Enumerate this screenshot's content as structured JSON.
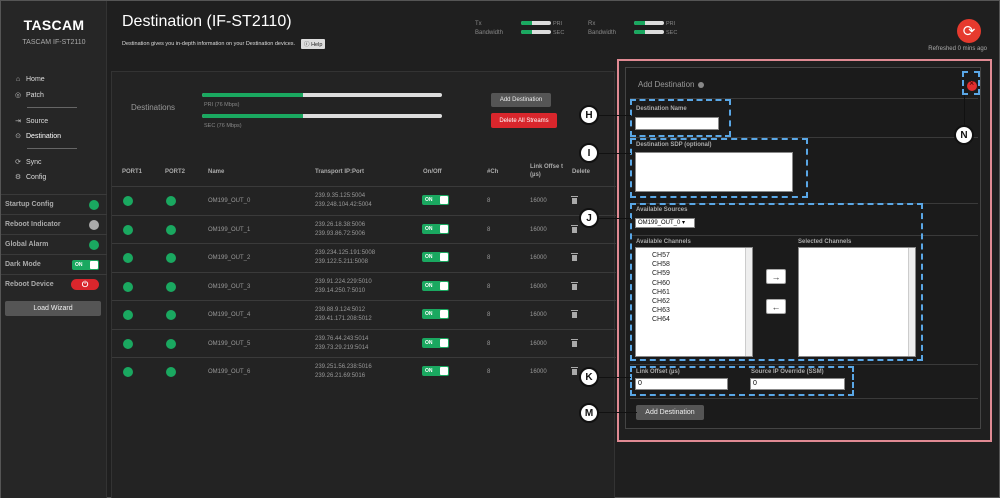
{
  "sidebar": {
    "brand": "TASCAM",
    "model": "TASCAM IF-ST2110",
    "nav": [
      {
        "label": "Home",
        "icon": "home-icon",
        "glyph": "⌂"
      },
      {
        "label": "Patch",
        "icon": "patch-icon",
        "glyph": "◎"
      },
      {
        "label": "Source",
        "icon": "source-icon",
        "glyph": "⇥"
      },
      {
        "label": "Destination",
        "icon": "destination-icon",
        "glyph": "⊙"
      },
      {
        "label": "Sync",
        "icon": "sync-icon",
        "glyph": "⟳"
      },
      {
        "label": "Config",
        "icon": "config-icon",
        "glyph": "⚙"
      }
    ],
    "status": {
      "startup_config": "Startup Config",
      "reboot_indicator": "Reboot Indicator",
      "global_alarm": "Global Alarm",
      "dark_mode": "Dark Mode",
      "dark_mode_value": "ON",
      "reboot_device": "Reboot Device",
      "power_glyph": "⏻"
    },
    "load_wizard": "Load Wizard"
  },
  "header": {
    "title": "Destination (IF-ST2110)",
    "description": "Destination gives you in-depth information on your Destination devices.",
    "help": "ⓘ Help",
    "tx_label": "Tx",
    "rx_label": "Rx",
    "bandwidth_label": "Bandwidth",
    "pri": "PRI",
    "sec": "SEC",
    "refresh_glyph": "⟳",
    "refreshed": "Refreshed 0 mins ago"
  },
  "destinations": {
    "title": "Destinations",
    "pri_label": "PRI (76 Mbps)",
    "sec_label": "SEC (76 Mbps)",
    "add_button": "Add Destination",
    "delete_all_button": "Delete All Streams",
    "columns": {
      "port1": "PORT1",
      "port2": "PORT2",
      "name": "Name",
      "transport": "Transport IP:Port",
      "onoff": "On/Off",
      "ch": "#Ch",
      "link_offset": "Link Offse t (µs)",
      "delete": "Delete"
    },
    "rows": [
      {
        "name": "OM199_OUT_0",
        "ip1": "239.9.35.125:5004",
        "ip2": "239.248.104.42:5004",
        "toggle": "ON",
        "ch": "8",
        "offset": "16000"
      },
      {
        "name": "OM199_OUT_1",
        "ip1": "239.26.18.38:5006",
        "ip2": "239.93.86.72:5006",
        "toggle": "ON",
        "ch": "8",
        "offset": "16000"
      },
      {
        "name": "OM199_OUT_2",
        "ip1": "239.234.125.191:5008",
        "ip2": "239.122.5.211:5008",
        "toggle": "ON",
        "ch": "8",
        "offset": "16000"
      },
      {
        "name": "OM199_OUT_3",
        "ip1": "239.91.224.229:5010",
        "ip2": "239.14.250.7:5010",
        "toggle": "ON",
        "ch": "8",
        "offset": "16000"
      },
      {
        "name": "OM199_OUT_4",
        "ip1": "239.88.9.124:5012",
        "ip2": "239.41.171.208:5012",
        "toggle": "ON",
        "ch": "8",
        "offset": "16000"
      },
      {
        "name": "OM199_OUT_5",
        "ip1": "239.76.44.243:5014",
        "ip2": "239.73.29.219:5014",
        "toggle": "ON",
        "ch": "8",
        "offset": "16000"
      },
      {
        "name": "OM199_OUT_6",
        "ip1": "239.251.56.238:5016",
        "ip2": "239.26.21.69:5016",
        "toggle": "ON",
        "ch": "8",
        "offset": "16000"
      }
    ]
  },
  "add_panel": {
    "title": "Add Destination",
    "name_label": "Destination Name",
    "name_value": "",
    "sdp_label": "Destination SDP (optional)",
    "sources_label": "Available Sources",
    "sources_selected": "OM199_OUT_0",
    "available_channels_label": "Available Channels",
    "selected_channels_label": "Selected Channels",
    "available_channels": [
      "CH57",
      "CH58",
      "CH59",
      "CH60",
      "CH61",
      "CH62",
      "CH63",
      "CH64"
    ],
    "move_right": "→",
    "move_left": "←",
    "link_offset_label": "Link Offset (µs)",
    "link_offset_value": "0",
    "source_ip_label": "Source IP Override (SSM)",
    "source_ip_value": "0",
    "add_button": "Add Destination"
  },
  "callouts": {
    "h": "H",
    "i": "I",
    "j": "J",
    "k": "K",
    "m": "M",
    "n": "N"
  },
  "colors": {
    "accent_green": "#1aa860",
    "alarm_red": "#d9262c",
    "callout_blue": "#5aa7e6",
    "frame_pink": "#e08a93"
  }
}
